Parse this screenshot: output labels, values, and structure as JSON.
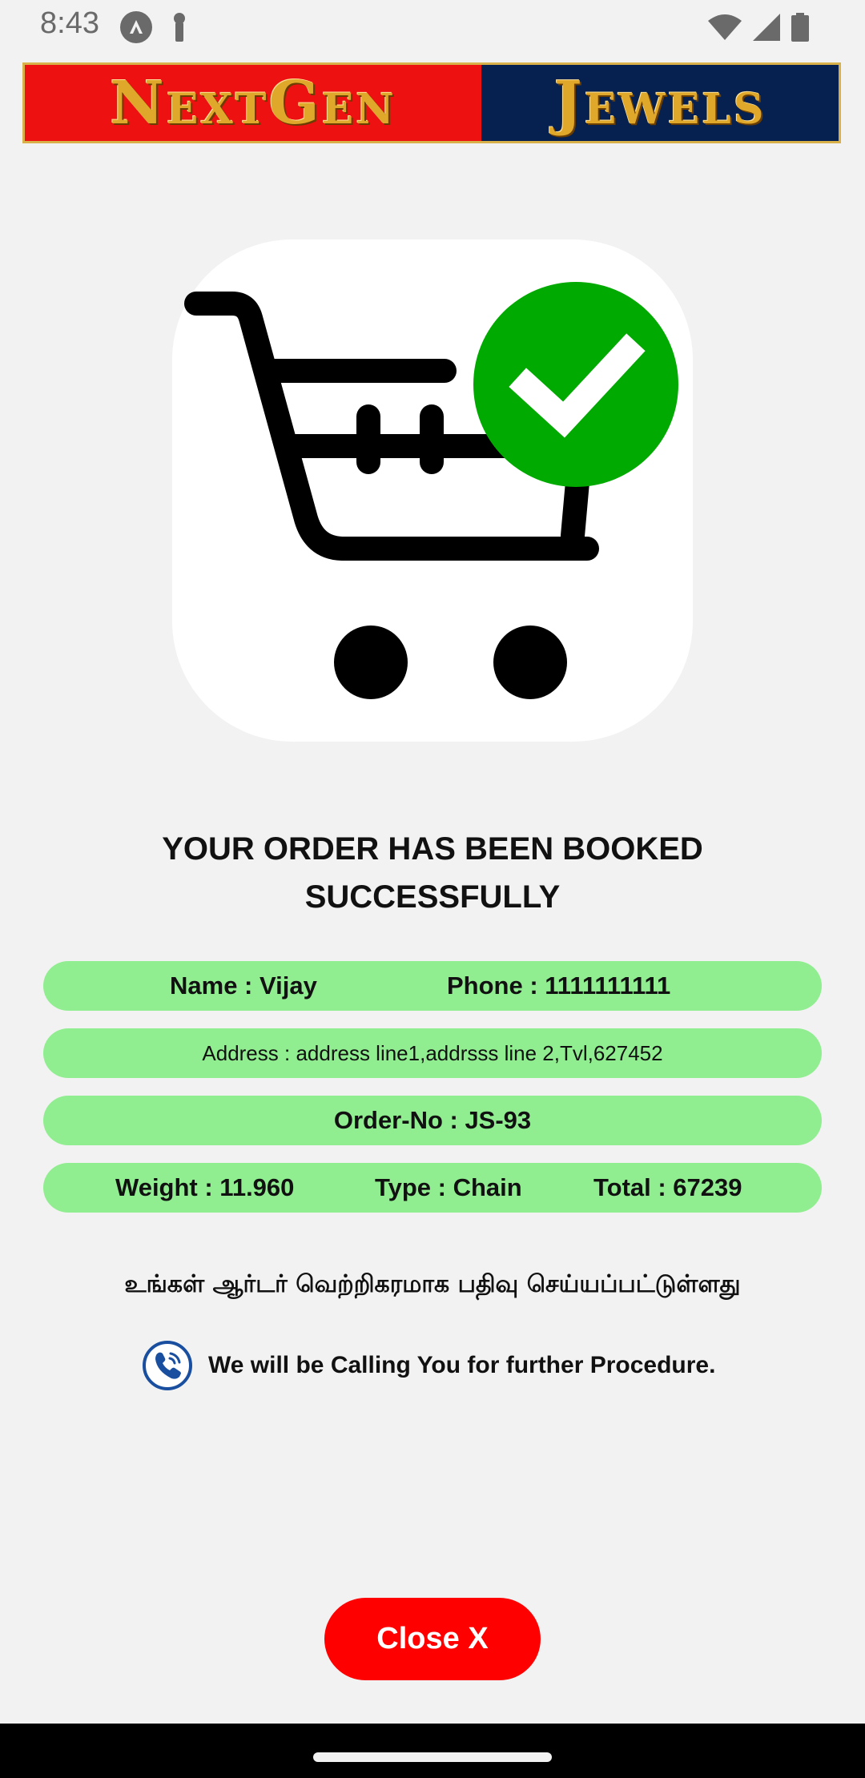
{
  "status_bar": {
    "time": "8:43",
    "icons": [
      "app-notification-icon",
      "key-icon",
      "wifi-icon",
      "signal-icon",
      "battery-icon"
    ]
  },
  "banner": {
    "part1": "NextGen",
    "part2": "Jewels",
    "colors": {
      "left_bg": "#ee1111",
      "right_bg": "#06204f",
      "text": "#e0a82a"
    }
  },
  "hero": {
    "icon": "cart-check-icon",
    "check_color": "#00aa00"
  },
  "title": {
    "line1": "YOUR ORDER HAS BEEN BOOKED",
    "line2": "SUCCESSFULLY"
  },
  "order": {
    "name": "Name : Vijay",
    "phone": "Phone : 1111111111",
    "address": "Address : address line1,addrsss line 2,Tvl,627452",
    "order_no": "Order-No : JS-93",
    "weight": "Weight : 11.960",
    "type": "Type : Chain",
    "total": "Total : 67239",
    "pill_color": "#90ee90"
  },
  "message": {
    "tamil": "உங்கள் ஆர்டர் வெற்றிகரமாக பதிவு செய்யப்பட்டுள்ளது",
    "call_icon": "phone-call-icon",
    "call_text": "We will be Calling You for further Procedure."
  },
  "actions": {
    "close_label": "Close X",
    "close_color": "#ff0000"
  }
}
